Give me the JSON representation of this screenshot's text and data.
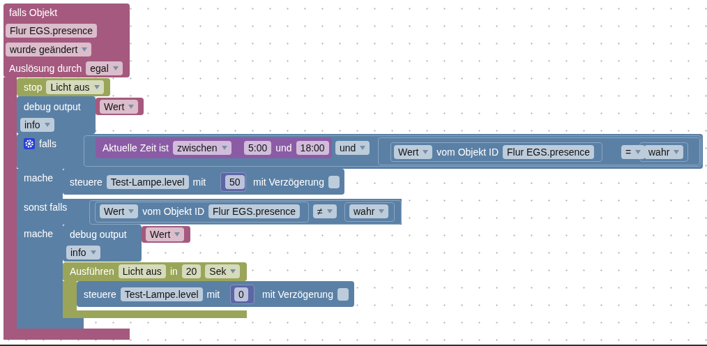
{
  "blocks": [
    {
      "kind": "event",
      "rows": [
        [
          {
            "kind": "label",
            "text": "falls Objekt"
          }
        ],
        [
          {
            "kind": "field",
            "text": "Flur EGS.presence"
          }
        ],
        [
          {
            "kind": "dropdown",
            "text": "wurde geändert"
          }
        ],
        [
          {
            "kind": "label",
            "text": "Auslösung durch"
          },
          {
            "kind": "dropdown",
            "text": "egal"
          }
        ]
      ]
    },
    {
      "kind": "timer",
      "rows": [
        [
          {
            "kind": "label",
            "text": "stop"
          },
          {
            "kind": "dropdown",
            "text": "Licht aus"
          }
        ]
      ]
    },
    {
      "kind": "action",
      "rows": [
        [
          {
            "kind": "label",
            "text": "debug output"
          }
        ],
        [
          {
            "kind": "dropdown",
            "text": "info"
          }
        ]
      ]
    },
    {
      "kind": "value",
      "rows": [
        [
          {
            "kind": "dropdown",
            "text": "Wert"
          }
        ]
      ]
    },
    {
      "kind": "action",
      "rows": [
        [
          {
            "kind": "mutator"
          },
          {
            "kind": "label",
            "text": "falls"
          }
        ],
        [
          {
            "kind": "label",
            "text": "mache"
          }
        ],
        [
          {
            "kind": "label",
            "text": "sonst falls"
          }
        ],
        [
          {
            "kind": "label",
            "text": "mache"
          }
        ]
      ]
    },
    {
      "kind": "time",
      "rows": [
        [
          {
            "kind": "label",
            "text": "Aktuelle Zeit ist"
          },
          {
            "kind": "dropdown",
            "text": "zwischen"
          }
        ],
        [
          {
            "kind": "field",
            "text": "5:00"
          },
          {
            "kind": "label",
            "text": "und"
          },
          {
            "kind": "field",
            "text": "18:00"
          }
        ]
      ]
    },
    {
      "kind": "logic",
      "rows": [
        [
          {
            "kind": "dropdown",
            "text": "und"
          }
        ]
      ]
    },
    {
      "kind": "logic",
      "rows": [
        [
          {
            "kind": "dropdown",
            "text": "Wert"
          },
          {
            "kind": "label",
            "text": "vom Objekt ID"
          },
          {
            "kind": "field",
            "text": "Flur EGS.presence"
          }
        ]
      ]
    },
    {
      "kind": "logic",
      "rows": [
        [
          {
            "kind": "dropdown",
            "text": "="
          }
        ]
      ]
    },
    {
      "kind": "logic",
      "rows": [
        [
          {
            "kind": "dropdown",
            "text": "wahr"
          }
        ]
      ]
    },
    {
      "kind": "action",
      "rows": [
        [
          {
            "kind": "label",
            "text": "steuere"
          },
          {
            "kind": "field",
            "text": "Test-Lampe.level"
          },
          {
            "kind": "label",
            "text": "mit"
          }
        ],
        [
          {
            "kind": "label",
            "text": "mit Verzögerung"
          },
          {
            "kind": "checkbox",
            "checked": false
          }
        ]
      ]
    },
    {
      "kind": "number",
      "rows": [
        [
          {
            "kind": "field",
            "text": "50"
          }
        ]
      ]
    },
    {
      "kind": "logic",
      "rows": [
        [
          {
            "kind": "dropdown",
            "text": "Wert"
          },
          {
            "kind": "label",
            "text": "vom Objekt ID"
          },
          {
            "kind": "field",
            "text": "Flur EGS.presence"
          }
        ]
      ]
    },
    {
      "kind": "logic",
      "rows": [
        [
          {
            "kind": "dropdown",
            "text": "≠"
          }
        ]
      ]
    },
    {
      "kind": "logic",
      "rows": [
        [
          {
            "kind": "dropdown",
            "text": "wahr"
          }
        ]
      ]
    },
    {
      "kind": "action",
      "rows": [
        [
          {
            "kind": "label",
            "text": "debug output"
          }
        ],
        [
          {
            "kind": "dropdown",
            "text": "info"
          }
        ]
      ]
    },
    {
      "kind": "value",
      "rows": [
        [
          {
            "kind": "dropdown",
            "text": "Wert"
          }
        ]
      ]
    },
    {
      "kind": "timer",
      "rows": [
        [
          {
            "kind": "label",
            "text": "Ausführen"
          },
          {
            "kind": "field",
            "text": "Licht aus"
          },
          {
            "kind": "label",
            "text": "in"
          },
          {
            "kind": "field",
            "text": "20"
          },
          {
            "kind": "dropdown",
            "text": "Sek"
          }
        ]
      ]
    },
    {
      "kind": "action",
      "rows": [
        [
          {
            "kind": "label",
            "text": "steuere"
          },
          {
            "kind": "field",
            "text": "Test-Lampe.level"
          },
          {
            "kind": "label",
            "text": "mit"
          }
        ],
        [
          {
            "kind": "label",
            "text": "mit Verzögerung"
          },
          {
            "kind": "checkbox",
            "checked": false
          }
        ]
      ]
    },
    {
      "kind": "number",
      "rows": [
        [
          {
            "kind": "field",
            "text": "0"
          }
        ]
      ]
    }
  ]
}
